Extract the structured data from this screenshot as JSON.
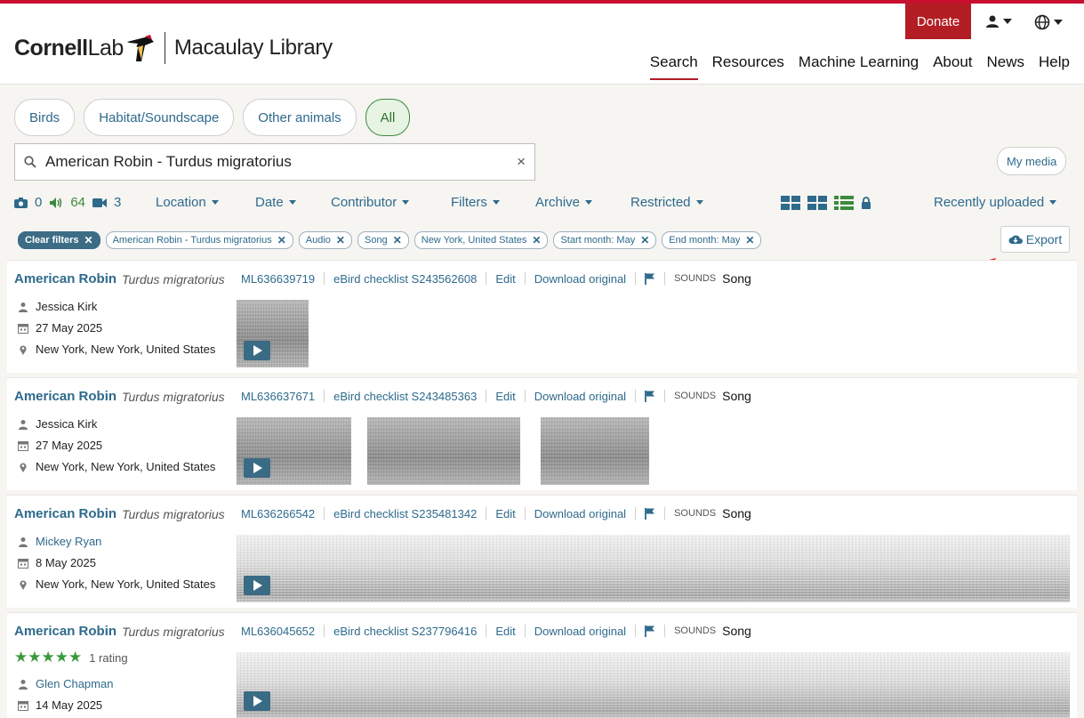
{
  "header": {
    "brand_a": "Cornell",
    "brand_b": "Lab",
    "brand_c": "Macaulay Library",
    "donate": "Donate",
    "nav": [
      "Search",
      "Resources",
      "Machine Learning",
      "About",
      "News",
      "Help"
    ]
  },
  "categories": [
    "Birds",
    "Habitat/Soundscape",
    "Other animals",
    "All"
  ],
  "search": {
    "value": "American Robin - Turdus migratorius",
    "clear": "×"
  },
  "my_media": "My media",
  "counts": {
    "photos": "0",
    "audio": "64",
    "video": "3"
  },
  "dropdowns": [
    "Location",
    "Date",
    "Contributor",
    "Filters",
    "Archive",
    "Restricted"
  ],
  "sort": "Recently uploaded",
  "filters": {
    "clear": "Clear filters",
    "chips": [
      "American Robin - Turdus migratorius",
      "Audio",
      "Song",
      "New York, United States",
      "Start month: May",
      "End month: May"
    ]
  },
  "export": "Export",
  "results": [
    {
      "name": "American Robin",
      "sci": "Turdus migratorius",
      "ml": "ML636639719",
      "checklist": "eBird checklist S243562608",
      "edit": "Edit",
      "download": "Download original",
      "sounds": "SOUNDS",
      "type": "Song",
      "contributor": "Jessica Kirk",
      "date": "27 May 2025",
      "location": "New York, New York, United States"
    },
    {
      "name": "American Robin",
      "sci": "Turdus migratorius",
      "ml": "ML636637671",
      "checklist": "eBird checklist S243485363",
      "edit": "Edit",
      "download": "Download original",
      "sounds": "SOUNDS",
      "type": "Song",
      "contributor": "Jessica Kirk",
      "date": "27 May 2025",
      "location": "New York, New York, United States"
    },
    {
      "name": "American Robin",
      "sci": "Turdus migratorius",
      "ml": "ML636266542",
      "checklist": "eBird checklist S235481342",
      "edit": "Edit",
      "download": "Download original",
      "sounds": "SOUNDS",
      "type": "Song",
      "contributor": "Mickey Ryan",
      "date": "8 May 2025",
      "location": "New York, New York, United States"
    },
    {
      "name": "American Robin",
      "sci": "Turdus migratorius",
      "ml": "ML636045652",
      "checklist": "eBird checklist S237796416",
      "edit": "Edit",
      "download": "Download original",
      "sounds": "SOUNDS",
      "type": "Song",
      "rating": "1 rating",
      "stars": "★★★★★",
      "contributor": "Glen Chapman",
      "date": "14 May 2025"
    }
  ],
  "colors": {
    "accent": "#2e6a8c",
    "brand_red": "#b21e23",
    "active_green": "#3d8a3d"
  },
  "icons": [
    "user-icon",
    "globe-icon",
    "search-icon",
    "camera-icon",
    "speaker-icon",
    "video-icon",
    "grid-view-icon",
    "list-view-icon",
    "lock-icon",
    "cloud-download-icon",
    "calendar-icon",
    "pin-icon",
    "flag-icon",
    "play-icon",
    "annotation-arrow"
  ]
}
